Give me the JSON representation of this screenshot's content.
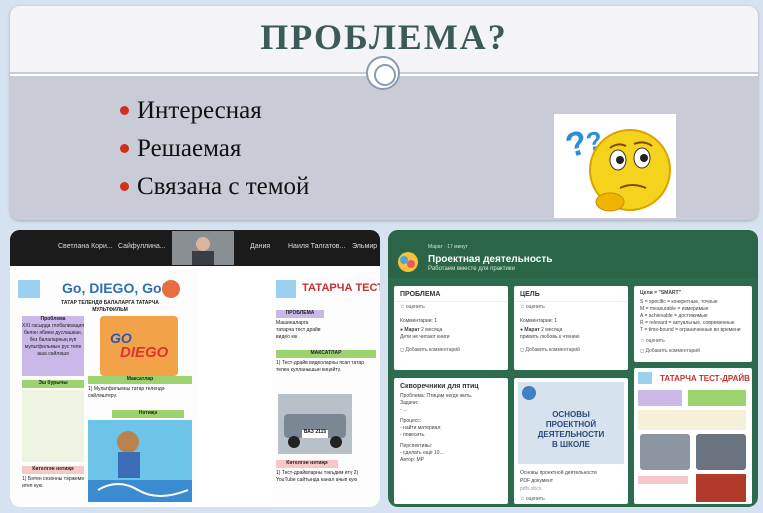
{
  "slide": {
    "title": "ПРОБЛЕМА?",
    "bullets": [
      "Интересная",
      "Решаемая",
      "Связана с темой"
    ]
  },
  "video_strip": {
    "participants": [
      "Светлана Кори...",
      "Сайфуллина...",
      "Дания",
      "Наиля Талгатов...",
      "Эльмир"
    ]
  },
  "left_doc": {
    "page1_title": "Go, DIEGO, Go!",
    "page1_subtitle": "ТАТАР ТЕЛЕНДӘ БАЛАЛАРГА ТАТАРЧА МУЛЬТФИЛЬМ",
    "page1_problem_head": "Проблема",
    "page1_problem_text": "XXI гасырда глобализация белән әбием дуслашкан, без балаларның күп мультфильмын рус теле аша сөйләшә",
    "page1_goal_head": "Максатлар",
    "page1_goal_text": "1) Мультфильмны татар телендә сөйләштерү.",
    "page1_tasks_head": "Эш бурычы",
    "page1_characters_head": "Нәтиҗә",
    "page1_result_head": "Көтелгән нәтиҗә",
    "page1_result_text": "1) Бәтен сезонны тәржемә итеп кую.",
    "page2_title": "ТАТАРЧА ТЕСТ-Д",
    "page2_problem_head": "ПРОБЛЕМА",
    "page2_problem_text": "Машиналарга татарча тест драйв видео юк",
    "page2_goal_head": "МАКСАТЛАР",
    "page2_goal_text": "1) Тест-драйв видеоларны ясап татар телен кулланышын киңәйтү.",
    "page2_plate": "ВАЗ 2115",
    "page2_result_head": "Көтелгән нәтиҗә",
    "page2_result_text": "1) Тест-драйвларны тәкъдим итү 2) YouTube сайтында канал ачып кую"
  },
  "padlet": {
    "author": "Марат",
    "time": "17 минут",
    "title": "Проектная деятельность",
    "subtitle": "Работаем вместе для практики",
    "col1_title": "ПРОБЛЕМА",
    "col2_title": "ЦЕЛЬ",
    "vote_label": "оценить",
    "comments_label": "Комментарии: 1",
    "comment1": "Дети не читают книги",
    "comment2": "привить любовь к чтению",
    "comment_time": "2 месяца",
    "add_comment": "Добавить комментарий",
    "smart_title": "Цели = \"SMART\"",
    "smart_rows": [
      [
        "S",
        "= specific",
        "= конкретные, точные"
      ],
      [
        "M",
        "= measurable",
        "= измеримые"
      ],
      [
        "A",
        "= achievable",
        "= достижимые"
      ],
      [
        "R",
        "= relevant",
        "= актуальные, современные"
      ],
      [
        "T",
        "= time-bound",
        "= ограниченные во времени"
      ]
    ],
    "card3_title": "Скворечники для птиц",
    "card3_text": [
      "Проблема: Птицам негде жить.",
      "Задачи:",
      "- ...",
      "Процесс:",
      "- найти материал;",
      "- повесить.",
      "Перспективы:",
      "- сделать ещё 10...",
      "Автор: МР"
    ],
    "book_title": [
      "ОСНОВЫ",
      "ПРОЕКТНОЙ",
      "ДЕЯТЕЛЬНОСТИ",
      "В ШКОЛЕ"
    ],
    "book_caption": "Основы проектной деятельности",
    "book_file": "PDF документ",
    "book_site": "pdfs.docs",
    "card5_title": "ТАТАРЧА ТЕСТ-ДРАЙВ"
  }
}
